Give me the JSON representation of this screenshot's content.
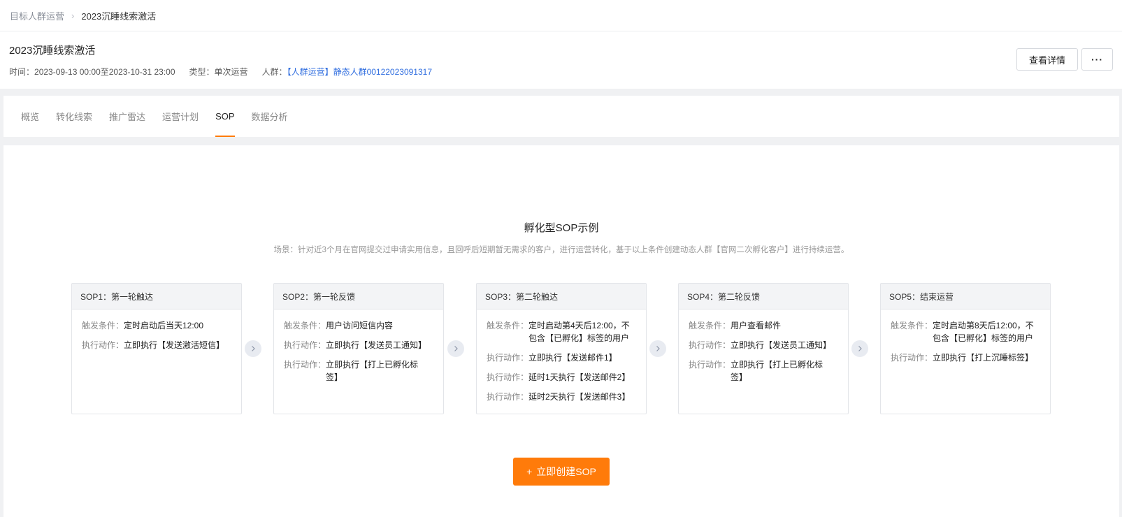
{
  "breadcrumb": {
    "parent": "目标人群运营",
    "separator": "›",
    "current": "2023沉睡线索激活"
  },
  "header": {
    "title": "2023沉睡线索激活",
    "time_label": "时间：",
    "time_value": "2023-09-13 00:00至2023-10-31 23:00",
    "type_label": "类型：",
    "type_value": "单次运营",
    "crowd_label": "人群：",
    "crowd_value": "【人群运营】静态人群00122023091317",
    "detail_button": "查看详情",
    "more_button": "···"
  },
  "tabs": [
    {
      "label": "概览",
      "active": false
    },
    {
      "label": "转化线索",
      "active": false
    },
    {
      "label": "推广雷达",
      "active": false
    },
    {
      "label": "运营计划",
      "active": false
    },
    {
      "label": "SOP",
      "active": true
    },
    {
      "label": "数据分析",
      "active": false
    }
  ],
  "example": {
    "title": "孵化型SOP示例",
    "description": "场景：针对近3个月在官网提交过申请实用信息，且回呼后短期暂无需求的客户，进行运营转化，基于以上条件创建动态人群【官网二次孵化客户】进行持续运营。"
  },
  "cards": [
    {
      "title": "SOP1：第一轮触达",
      "rows": [
        {
          "k": "触发条件：",
          "v": "定时启动后当天12:00"
        },
        {
          "k": "执行动作：",
          "v": "立即执行【发送激活短信】"
        }
      ]
    },
    {
      "title": "SOP2：第一轮反馈",
      "rows": [
        {
          "k": "触发条件：",
          "v": "用户访问短信内容"
        },
        {
          "k": "执行动作：",
          "v": "立即执行【发送员工通知】"
        },
        {
          "k": "执行动作：",
          "v": "立即执行【打上已孵化标签】"
        }
      ]
    },
    {
      "title": "SOP3：第二轮触达",
      "rows": [
        {
          "k": "触发条件：",
          "v": "定时启动第4天后12:00，不包含【已孵化】标签的用户"
        },
        {
          "k": "执行动作：",
          "v": "立即执行【发送邮件1】"
        },
        {
          "k": "执行动作：",
          "v": "延时1天执行【发送邮件2】"
        },
        {
          "k": "执行动作：",
          "v": "延时2天执行【发送邮件3】"
        }
      ]
    },
    {
      "title": "SOP4：第二轮反馈",
      "rows": [
        {
          "k": "触发条件：",
          "v": "用户查看邮件"
        },
        {
          "k": "执行动作：",
          "v": "立即执行【发送员工通知】"
        },
        {
          "k": "执行动作：",
          "v": "立即执行【打上已孵化标签】"
        }
      ]
    },
    {
      "title": "SOP5：结束运营",
      "rows": [
        {
          "k": "触发条件：",
          "v": "定时启动第8天后12:00，不包含【已孵化】标签的用户"
        },
        {
          "k": "执行动作：",
          "v": "立即执行【打上沉睡标签】"
        }
      ]
    }
  ],
  "create_button": {
    "plus": "+",
    "label": "立即创建SOP"
  },
  "colors": {
    "accent": "#ff7b0a",
    "link": "#2f6ddf"
  }
}
